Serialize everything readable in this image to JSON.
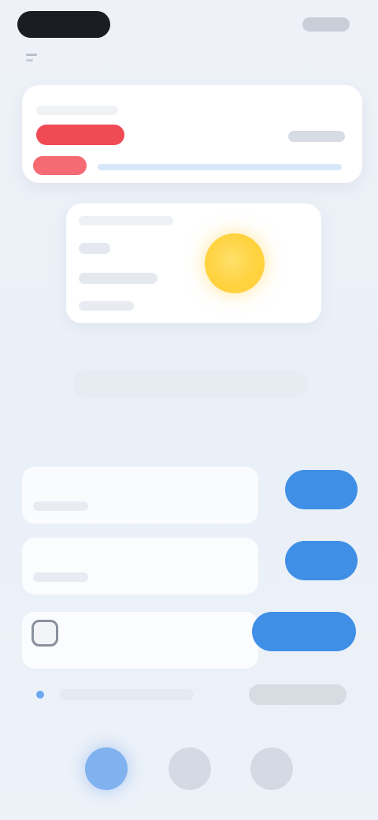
{
  "status_bar": {
    "brand": "",
    "right": ""
  },
  "alert": {
    "tag_top": "",
    "tag": "",
    "title": "",
    "right_text": "",
    "tag2": ""
  },
  "weather": {
    "line1": "",
    "line2": "",
    "line3": "",
    "line4": "",
    "icon": "sun-icon"
  },
  "section": {
    "title": ""
  },
  "rows": [
    {
      "title": "",
      "sub": "",
      "button": ""
    },
    {
      "title": "",
      "sub": "",
      "button": ""
    },
    {
      "title": "",
      "button": "",
      "icon": "gear-icon"
    }
  ],
  "info_row": {
    "text": "",
    "pill": ""
  },
  "bottom_nav": [
    {
      "icon": "home-icon",
      "glyph": "",
      "active": true
    },
    {
      "icon": "compass-icon",
      "glyph": "",
      "active": false
    },
    {
      "icon": "user-icon",
      "glyph": "",
      "active": false
    }
  ],
  "colors": {
    "accent": "#3f8fe6",
    "alert_red": "#f04a55",
    "sun": "#ffd23f",
    "background": "#eef2f8"
  }
}
